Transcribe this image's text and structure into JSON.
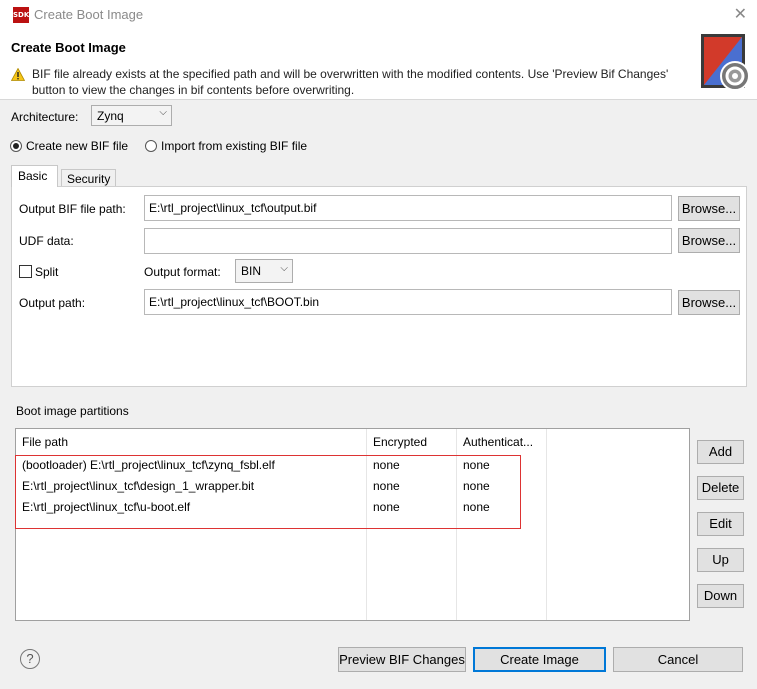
{
  "window": {
    "title": "Create Boot Image",
    "logo_text": "SDK"
  },
  "header": {
    "title": "Create Boot Image",
    "warning": "BIF file already exists at the specified path and will be overwritten with the modified contents. Use 'Preview Bif Changes' button to view the changes in bif contents before overwriting."
  },
  "architecture": {
    "label": "Architecture:",
    "value": "Zynq"
  },
  "mode": {
    "create_label": "Create new BIF file",
    "import_label": "Import from existing BIF file",
    "selected": "create"
  },
  "tabs": [
    {
      "label": "Basic"
    },
    {
      "label": "Security"
    }
  ],
  "basic": {
    "output_bif_label": "Output BIF file path:",
    "output_bif_value": "E:\\rtl_project\\linux_tcf\\output.bif",
    "udf_label": "UDF data:",
    "udf_value": "",
    "split_label": "Split",
    "split_checked": false,
    "format_label": "Output format:",
    "format_value": "BIN",
    "output_path_label": "Output path:",
    "output_path_value": "E:\\rtl_project\\linux_tcf\\BOOT.bin",
    "browse_label": "Browse..."
  },
  "partitions": {
    "label": "Boot image partitions",
    "columns": [
      "File path",
      "Encrypted",
      "Authenticat..."
    ],
    "rows": [
      [
        "(bootloader) E:\\rtl_project\\linux_tcf\\zynq_fsbl.elf",
        "none",
        "none"
      ],
      [
        "E:\\rtl_project\\linux_tcf\\design_1_wrapper.bit",
        "none",
        "none"
      ],
      [
        "E:\\rtl_project\\linux_tcf\\u-boot.elf",
        "none",
        "none"
      ]
    ],
    "buttons": {
      "add": "Add",
      "delete": "Delete",
      "edit": "Edit",
      "up": "Up",
      "down": "Down"
    }
  },
  "footer": {
    "help": "?",
    "preview": "Preview BIF Changes",
    "create": "Create Image",
    "cancel": "Cancel"
  },
  "colors": {
    "highlight_box": "#dd3333",
    "default_button_border": "#0078d7"
  }
}
